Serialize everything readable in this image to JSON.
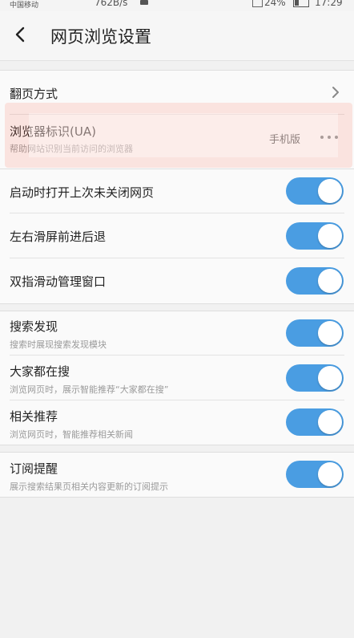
{
  "status_bar": {
    "carrier": "中国移动",
    "net_speed": "762B/s",
    "battery": "24%",
    "time": "17:29"
  },
  "header": {
    "back_icon": "chevron-left-icon",
    "title": "网页浏览设置"
  },
  "section1": {
    "page_turn": {
      "label": "翻页方式"
    },
    "ua": {
      "label": "浏览器标识(UA)",
      "sub": "帮助网站识别当前访问的浏览器",
      "value": "手机版"
    }
  },
  "section2": {
    "items": [
      {
        "label": "启动时打开上次未关闭网页",
        "on": true
      },
      {
        "label": "左右滑屏前进后退",
        "on": true
      },
      {
        "label": "双指滑动管理窗口",
        "on": true
      }
    ]
  },
  "section3": {
    "items": [
      {
        "label": "搜索发现",
        "sub": "搜索时展现搜索发现模块",
        "on": true
      },
      {
        "label": "大家都在搜",
        "sub": "浏览网页时，展示智能推荐“大家都在搜”",
        "on": true
      },
      {
        "label": "相关推荐",
        "sub": "浏览网页时，智能推荐相关新闻",
        "on": true
      }
    ]
  },
  "section4": {
    "items": [
      {
        "label": "订阅提醒",
        "sub": "展示搜索结果页相关内容更新的订阅提示",
        "on": true
      }
    ]
  },
  "colors": {
    "toggle_on": "#4a9de2",
    "highlight": "#ff6e5a"
  }
}
